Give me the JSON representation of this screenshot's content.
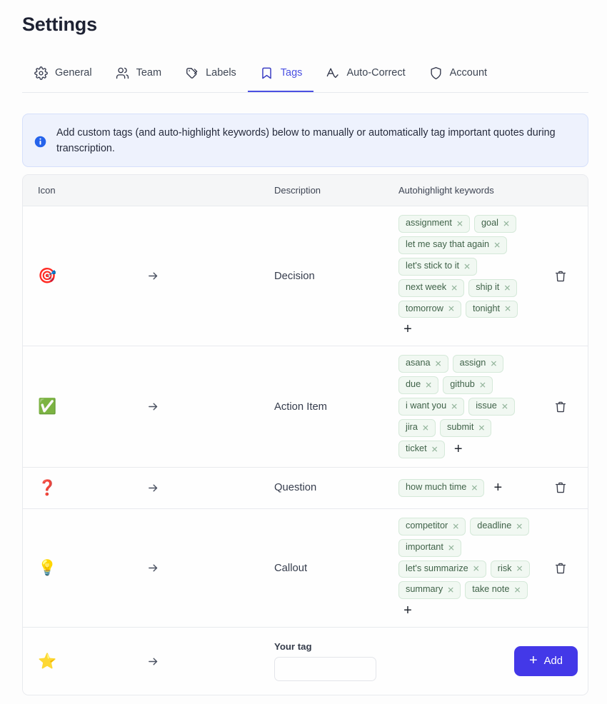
{
  "header": {
    "title": "Settings"
  },
  "tabs": [
    {
      "label": "General",
      "icon": "gear-icon",
      "active": false
    },
    {
      "label": "Team",
      "icon": "people-icon",
      "active": false
    },
    {
      "label": "Labels",
      "icon": "labels-tag-icon",
      "active": false
    },
    {
      "label": "Tags",
      "icon": "bookmark-icon",
      "active": true
    },
    {
      "label": "Auto-Correct",
      "icon": "a-check-icon",
      "active": false
    },
    {
      "label": "Account",
      "icon": "shield-icon",
      "active": false
    }
  ],
  "banner": {
    "icon": "info-icon",
    "text": "Add custom tags (and auto-highlight keywords) below to manually or automatically tag important quotes during transcription."
  },
  "table": {
    "columns": {
      "icon": "Icon",
      "description": "Description",
      "keywords": "Autohighlight keywords"
    },
    "rows": [
      {
        "icon": "🎯",
        "icon_name": "target-emoji",
        "description": "Decision",
        "keywords": [
          "assignment",
          "goal",
          "let me say that again",
          "let's stick to it",
          "next week",
          "ship it",
          "tomorrow",
          "tonight"
        ]
      },
      {
        "icon": "✅",
        "icon_name": "check-mark-emoji",
        "description": "Action Item",
        "keywords": [
          "asana",
          "assign",
          "due",
          "github",
          "i want you",
          "issue",
          "jira",
          "submit",
          "ticket"
        ]
      },
      {
        "icon": "❓",
        "icon_name": "question-mark-emoji",
        "description": "Question",
        "keywords": [
          "how much time"
        ]
      },
      {
        "icon": "💡",
        "icon_name": "light-bulb-emoji",
        "description": "Callout",
        "keywords": [
          "competitor",
          "deadline",
          "important",
          "let's summarize",
          "risk",
          "summary",
          "take note"
        ]
      }
    ],
    "new_row": {
      "icon": "⭐",
      "icon_name": "star-emoji",
      "label": "Your tag",
      "value": "",
      "placeholder": "",
      "add_label": "Add",
      "add_plus": "+"
    },
    "add_keyword_glyph": "+",
    "chip_remove_glyph": "✕"
  },
  "colors": {
    "accent": "#4338e8",
    "tab_active": "#4a50e2",
    "chip_bg": "#f1f8f2",
    "chip_border": "#d5e9d9",
    "chip_text": "#3f6248",
    "banner_bg": "#eef2fd",
    "banner_border": "#d6e0fb"
  }
}
